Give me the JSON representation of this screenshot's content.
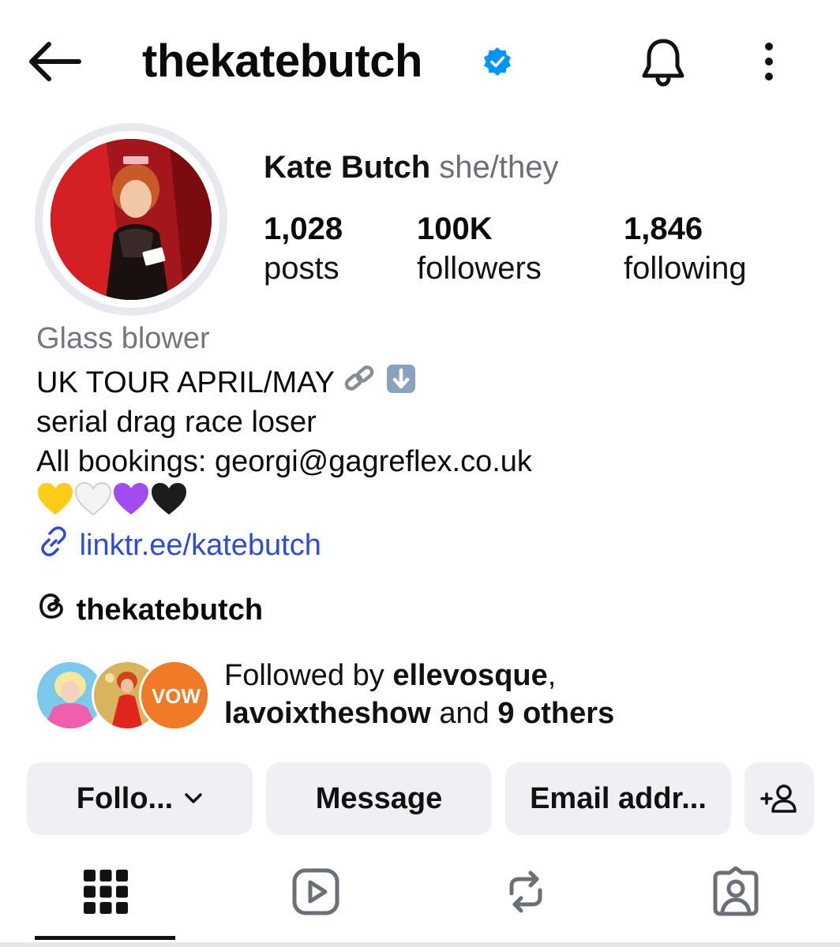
{
  "header": {
    "username": "thekatebutch",
    "verified": true,
    "icons": [
      "back-arrow-icon",
      "verified-badge-icon",
      "bell-icon",
      "more-vertical-icon"
    ]
  },
  "profile": {
    "display_name": "Kate Butch",
    "pronouns": "she/they",
    "stats": [
      {
        "value": "1,028",
        "label": "posts"
      },
      {
        "value": "100K",
        "label": "followers"
      },
      {
        "value": "1,846",
        "label": "following"
      }
    ]
  },
  "bio": {
    "category": "Glass blower",
    "line1": "UK TOUR APRIL/MAY",
    "line2": "serial drag race loser",
    "line3": "All bookings: georgi@gagreflex.co.uk",
    "hearts": [
      "yellow-heart",
      "white-heart",
      "purple-heart",
      "black-heart"
    ],
    "link": "linktr.ee/katebutch",
    "threads_handle": "thekatebutch"
  },
  "followed_by": {
    "prefix": "Followed by ",
    "user1": "ellevosque",
    "sep": ",",
    "user2": "lavoixtheshow",
    "and": " and ",
    "others": "9 others",
    "badge_text": "VOW"
  },
  "actions": {
    "follow": "Follo...",
    "message": "Message",
    "email": "Email addr..."
  },
  "tabs": [
    "grid-icon",
    "reels-icon",
    "reposts-icon",
    "tagged-icon"
  ],
  "colors": {
    "accent": "#0095f6",
    "link": "#2f4bd6",
    "button_bg": "#eef0f3",
    "muted": "#73777d"
  }
}
